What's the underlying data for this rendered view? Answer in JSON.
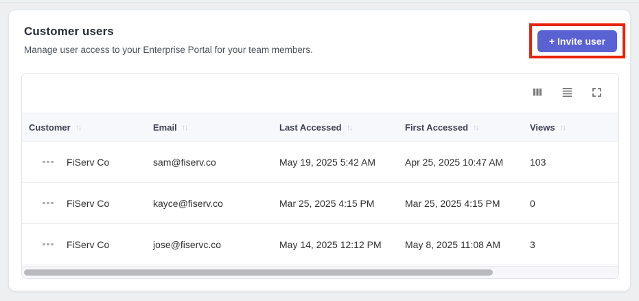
{
  "page": {
    "title": "Customer users",
    "subtitle": "Manage user access to your Enterprise Portal for your team members."
  },
  "invite_button": {
    "label": "+ Invite user"
  },
  "annotation": {
    "color": "#e8220b",
    "target": "invite-user-button"
  },
  "toolbar_icons": [
    {
      "name": "columns-icon"
    },
    {
      "name": "density-icon"
    },
    {
      "name": "fullscreen-icon"
    }
  ],
  "table": {
    "columns": [
      {
        "label": "Customer",
        "sort_icon": "↑↓"
      },
      {
        "label": "Email",
        "sort_icon": "↑↓"
      },
      {
        "label": "Last Accessed",
        "sort_icon": "↑↓"
      },
      {
        "label": "First Accessed",
        "sort_icon": "↑↓"
      },
      {
        "label": "Views",
        "sort_icon": "↑↓"
      }
    ],
    "rows": [
      {
        "customer": "FiServ Co",
        "email": "sam@fiserv.co",
        "last_accessed": "May 19, 2025 5:42 AM",
        "first_accessed": "Apr 25, 2025 10:47 AM",
        "views": "103"
      },
      {
        "customer": "FiServ Co",
        "email": "kayce@fiserv.co",
        "last_accessed": "Mar 25, 2025 4:15 PM",
        "first_accessed": "Mar 25, 2025 4:15 PM",
        "views": "0"
      },
      {
        "customer": "FiServ Co",
        "email": "jose@fiservc.co",
        "last_accessed": "May 14, 2025 12:12 PM",
        "first_accessed": "May 8, 2025 11:08 AM",
        "views": "3"
      }
    ]
  },
  "colors": {
    "accent": "#5a61d2",
    "annotation_red": "#e8220b",
    "header_bg": "#f7f8fb",
    "page_bg": "#edeff1"
  }
}
